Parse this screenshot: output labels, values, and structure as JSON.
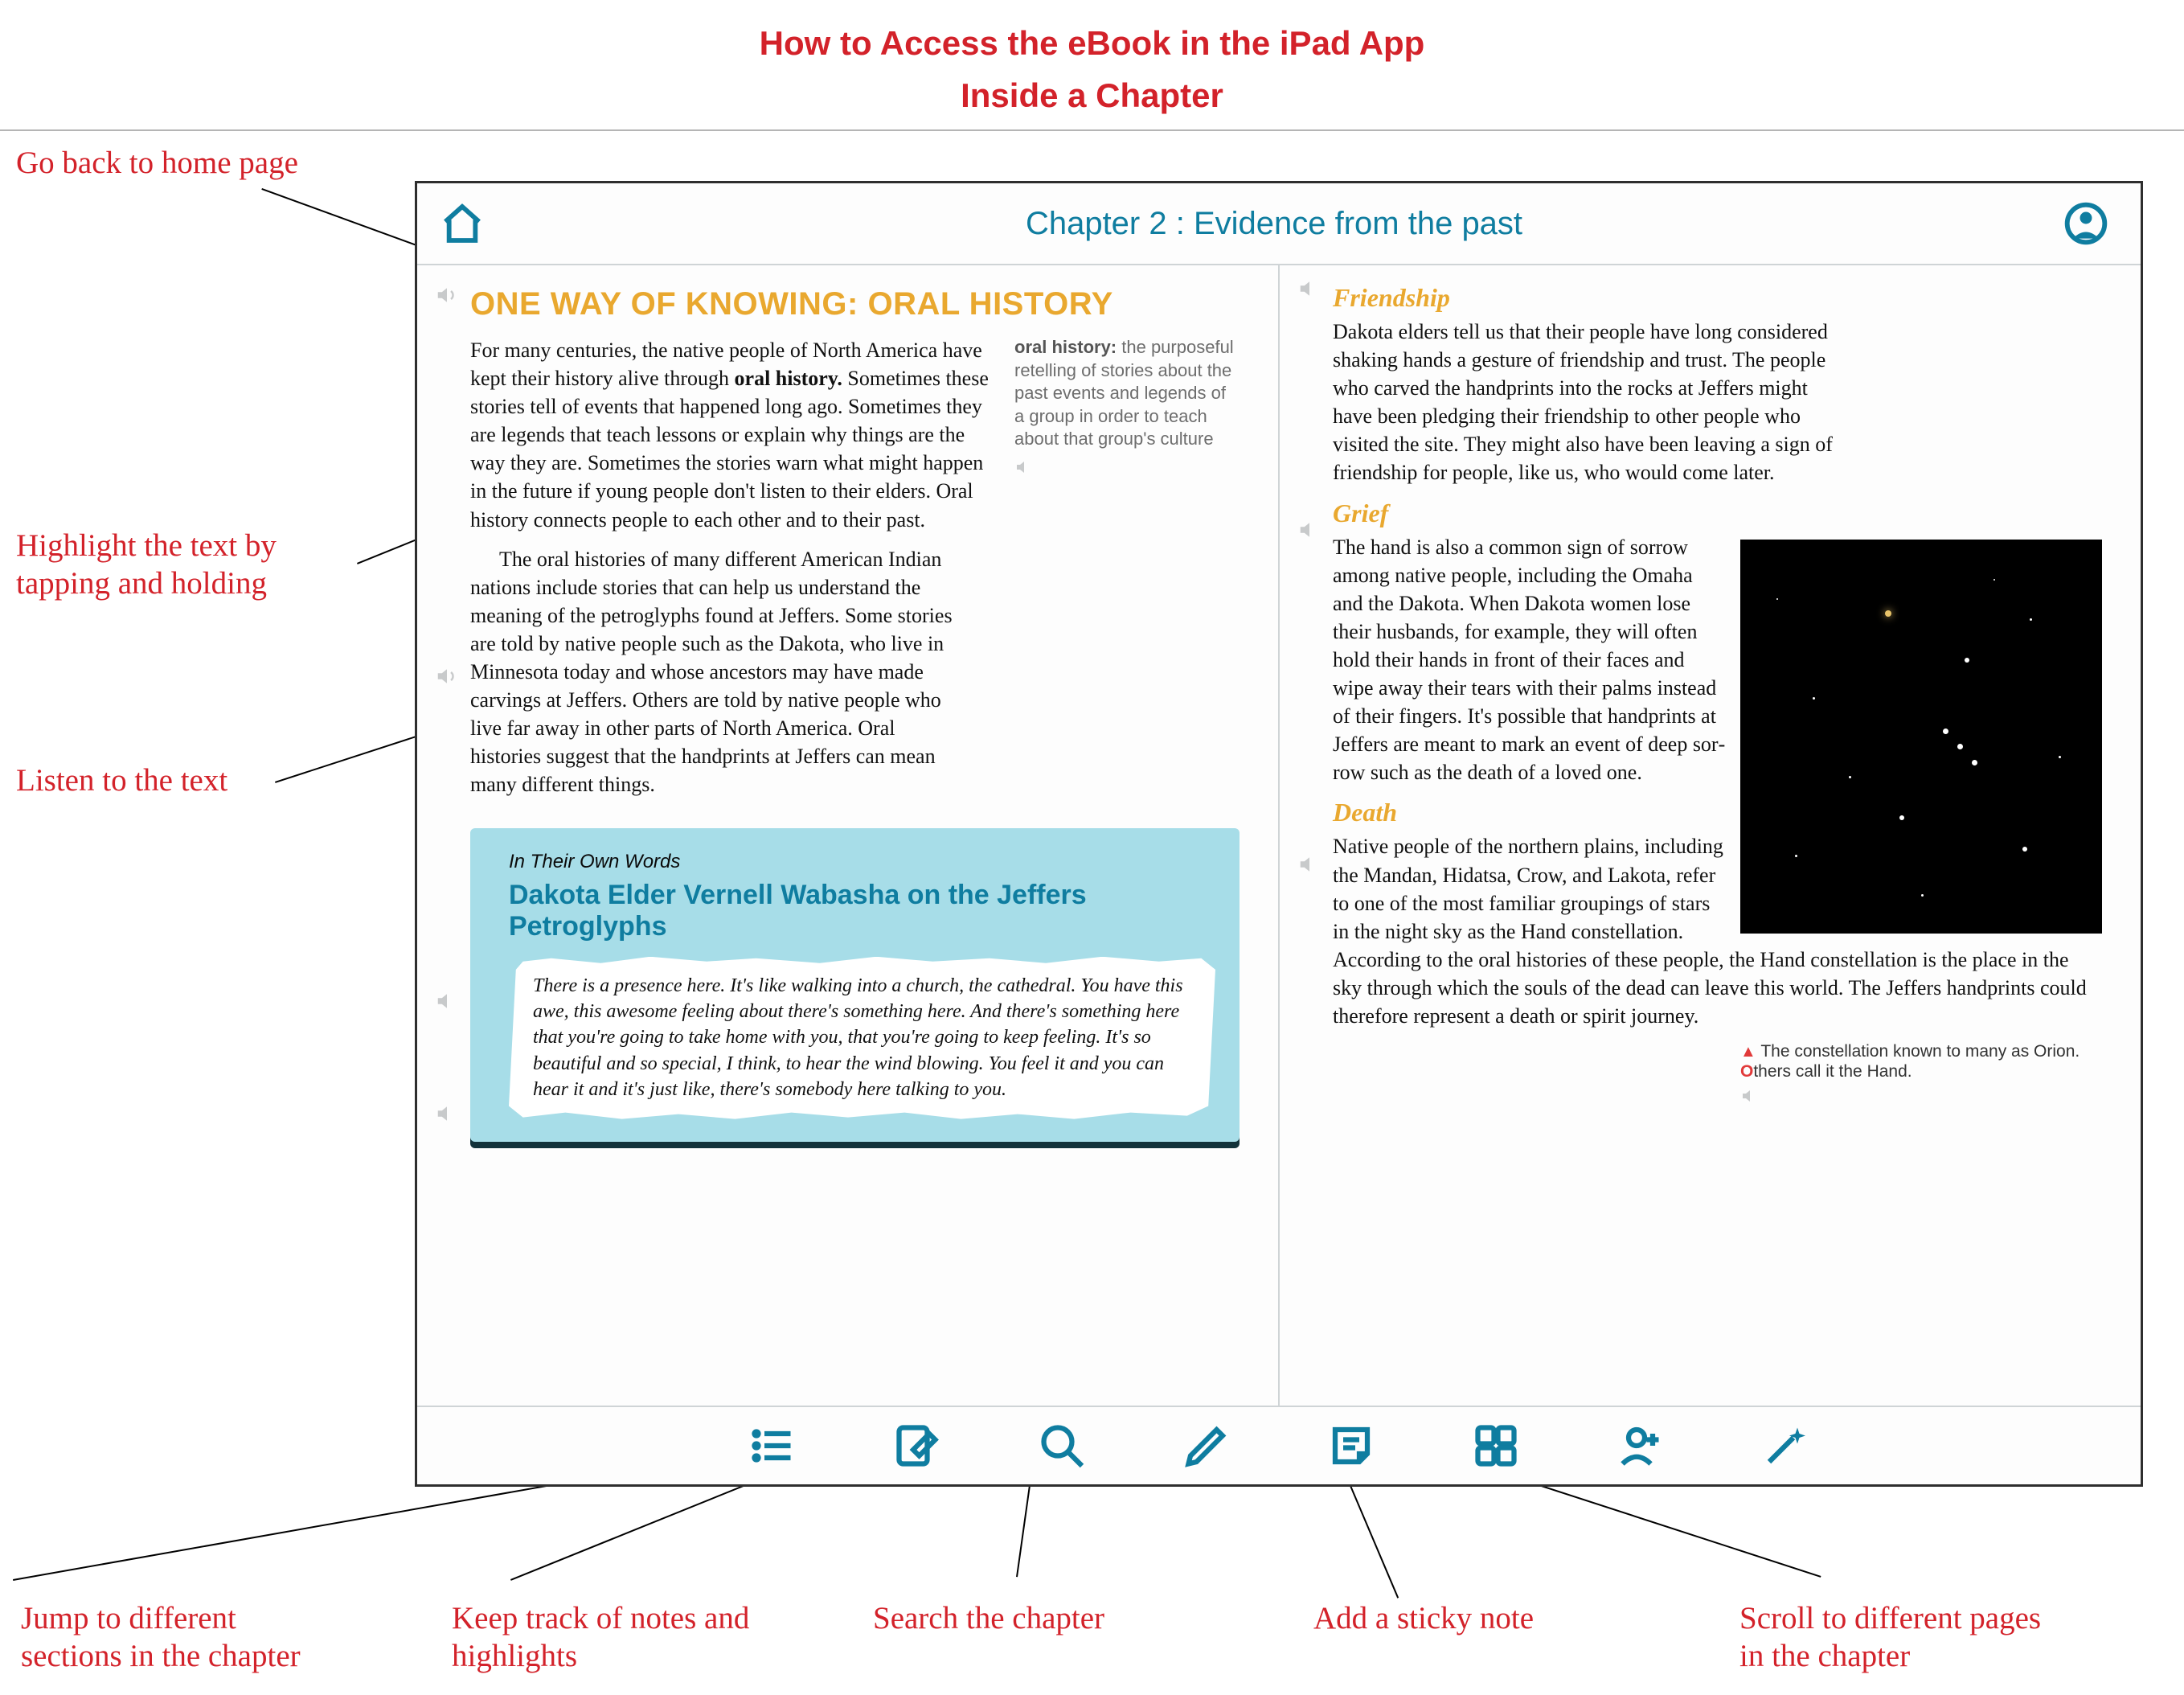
{
  "doc": {
    "title_line1": "How to Access the eBook in the iPad App",
    "title_line2": "Inside a Chapter"
  },
  "callouts": {
    "home": "Go back to home page",
    "highlight_l1": "Highlight the text by",
    "highlight_l2": "tapping and holding",
    "listen": "Listen to the text",
    "sections_l1": "Jump to different",
    "sections_l2": "sections in the chapter",
    "notes_l1": "Keep track of notes and",
    "notes_l2": "highlights",
    "search": "Search the chapter",
    "sticky": "Add a sticky note",
    "pages_l1": "Scroll to different pages",
    "pages_l2": "in the chapter"
  },
  "header": {
    "chapter_title": "Chapter 2 : Evidence from the past"
  },
  "left_page": {
    "heading": "ONE WAY OF KNOWING: ORAL HISTORY",
    "p1_a": "For many centuries, the native people of North America have kept their history alive through ",
    "p1_b": "oral history.",
    "p1_c": " Sometimes these stories tell of events that happened long ago. Sometimes they are legends that teach lessons or explain why things are the way they are. Sometimes the stories warn what might hap­pen in the future if young people don't listen to their elders. Oral history connects people to each other and to their past.",
    "def_key": "oral history:",
    "def_val": " the purposeful retelling of stories about the past events and legends of a group in order to teach about that group's culture",
    "p2": "The oral histories of many different American Indian nations include stories that can help us understand the meaning of the petroglyphs found at Jeffers. Some stories are told by native people such as the Dakota, who live in Minnesota today and whose ancestors may have made carvings at Jeffers. Others are told by native people who live far away in other parts of North America. Oral histories suggest that the handprints at Jeffers can mean many different things.",
    "quote": {
      "kicker": "In Their Own Words",
      "title": "Dakota Elder Vernell Wabasha on the Jeffers Petroglyphs",
      "body": "There is a presence here. It's like walking into a church, the cathedral. You have this awe, this awesome feeling about there's something here. And there's something here that you're going to take home with you, that you're going to keep feeling. It's so beautiful and so special, I think, to hear the wind blowing. You feel it and you can hear it and it's just like, there's somebody here talking to you."
    }
  },
  "right_page": {
    "sections": {
      "friendship": {
        "heading": "Friendship",
        "body": "Dakota elders tell us that their people have long con­sidered shaking hands a gesture of friendship and trust. The people who carved the handprints into the rocks at Jeffers might have been pledging their friendship to other people who visited the site. They might also have been leaving a sign of friendship for people, like us, who would come later."
      },
      "grief": {
        "heading": "Grief",
        "body": "The hand is also a common sign of sorrow among native people, including the Omaha and the Dakota. When Dakota women lose their hus­bands, for example, they will often hold their hands in front of their faces and wipe away their tears with their palms instead of their fingers. It's possible that handprints at Jeffers are meant to mark an event of deep sor­row such as the death of a loved one."
      },
      "death": {
        "heading": "Death",
        "body": "Native people of the northern plains, including the Mandan, Hidatsa, Crow, and Lakota, refer to one of the most familiar groupings of stars in the night sky as the Hand constellation. According to the oral histories of these people, the Hand constellation is the place in the sky through which the souls of the dead can leave this world. The Jeffers handprints could therefore represent a death or spirit journey."
      }
    },
    "caption_prefix_tri": "▲ ",
    "caption_main": "The constellation known to many as Orion. ",
    "caption_o": "O",
    "caption_rest": "thers call it the Hand."
  },
  "toolbar": {
    "sections": "sections-icon",
    "notes": "notes-icon",
    "search": "search-icon",
    "highlight": "highlight-icon",
    "sticky": "sticky-note-icon",
    "grid": "page-grid-icon",
    "share": "share-icon",
    "wand": "wand-icon"
  }
}
